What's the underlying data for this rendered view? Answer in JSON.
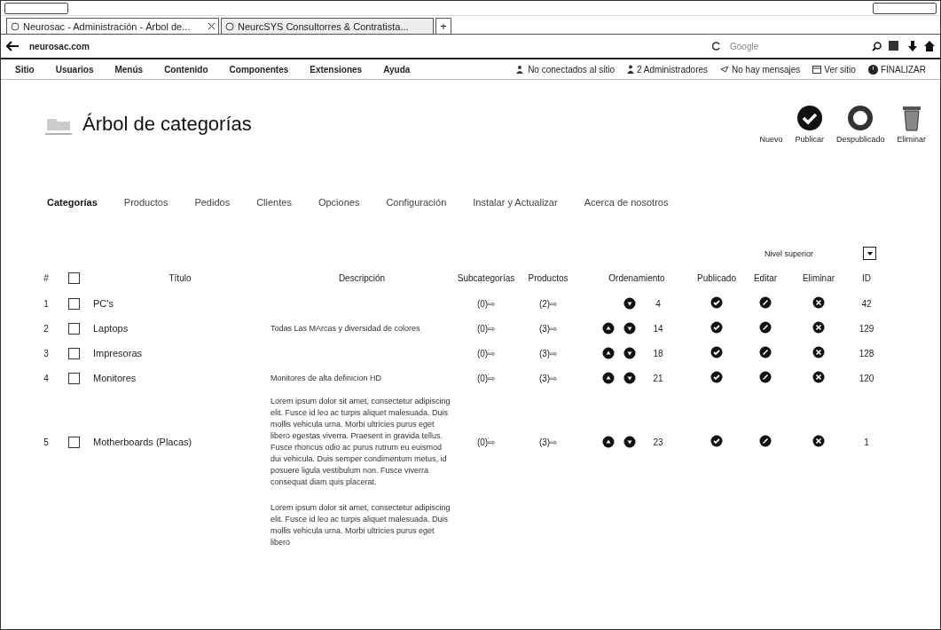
{
  "browser": {
    "tabs": [
      {
        "title": "Neurosac - Administración - Árbol de...",
        "selected": true,
        "closable": true
      },
      {
        "title": "NeurcSYS Consultorres & Contratista...",
        "selected": false,
        "closable": false
      }
    ],
    "new_tab": "+",
    "address": {
      "domain": "neurosac.com"
    },
    "search": {
      "placeholder": "Google"
    }
  },
  "admin_menu": {
    "items": [
      "Sitio",
      "Usuarios",
      "Menús",
      "Contenido",
      "Componentes",
      "Extensiones",
      "Ayuda"
    ],
    "status": [
      {
        "label": "No conectados al sitio",
        "kind": "users"
      },
      {
        "label": "2 Administradores",
        "kind": "admins"
      },
      {
        "label": "No hay mensajes",
        "kind": "messages"
      },
      {
        "label": "Ver sitio",
        "kind": "site"
      },
      {
        "label": "FINALIZAR",
        "kind": "logout"
      }
    ]
  },
  "page": {
    "title": "Árbol de categorías",
    "toolbar": [
      {
        "label": "Nuevo",
        "kind": "new"
      },
      {
        "label": "Publicar",
        "kind": "publish"
      },
      {
        "label": "Despublicado",
        "kind": "unpublish"
      },
      {
        "label": "Eliminar",
        "kind": "delete"
      }
    ]
  },
  "nav": [
    {
      "label": "Categorías",
      "selected": true
    },
    {
      "label": "Productos",
      "selected": false
    },
    {
      "label": "Pedidos",
      "selected": false
    },
    {
      "label": "Clientes",
      "selected": false
    },
    {
      "label": "Opciones",
      "selected": false
    },
    {
      "label": "Configuración",
      "selected": false
    },
    {
      "label": "Instalar y Actualizar",
      "selected": false
    },
    {
      "label": "Acerca de nosotros",
      "selected": false
    }
  ],
  "filter": {
    "label": "Nivel superior"
  },
  "table": {
    "select_all": {
      "checked": false
    },
    "columns": [
      "#",
      "Título",
      "Descripción",
      "Subcategorías",
      "Productos",
      "Ordenamiento",
      "Publicado",
      "Editar",
      "Eliminar",
      "ID"
    ],
    "rows": [
      {
        "num": "1",
        "checked": false,
        "title": "PC's",
        "description": "",
        "subcategories": "(0)⇨",
        "products": "(2)⇨",
        "up": false,
        "down": true,
        "order": "4",
        "published": true,
        "id": "42"
      },
      {
        "num": "2",
        "checked": false,
        "title": "Laptops",
        "description": "Todas Las MArcas y diversidad de colores",
        "subcategories": "(0)⇨",
        "products": "(3)⇨",
        "up": true,
        "down": true,
        "order": "14",
        "published": true,
        "id": "129"
      },
      {
        "num": "3",
        "checked": false,
        "title": "Impresoras",
        "description": "",
        "subcategories": "(0)⇨",
        "products": "(3)⇨",
        "up": true,
        "down": true,
        "order": "18",
        "published": true,
        "id": "128"
      },
      {
        "num": "4",
        "checked": false,
        "title": "Monitores",
        "description": "Monitores de alta definicion HD",
        "subcategories": "(0)⇨",
        "products": "(3)⇨",
        "up": true,
        "down": true,
        "order": "21",
        "published": true,
        "id": "120"
      },
      {
        "num": "5",
        "checked": false,
        "title": "Motherboards (Placas)",
        "description": "Lorem ipsum dolor sit amet, consectetur adipiscing elit. Fusce id leo ac turpis aliquet malesuada. Duis mollis vehicula urna. Morbi ultricies purus eget libero egestas viverra. Praesent in gravida tellus. Fusce rhoncus odio ac purus rutrum eu euismod dui vehicula. Duis semper condimentum metus, id posuere ligula vestibulum non. Fusce viverra consequat diam quis placerat.",
        "subcategories": "(0)⇨",
        "products": "(3)⇨",
        "up": true,
        "down": true,
        "order": "23",
        "published": true,
        "id": "1"
      },
      {
        "partial": true,
        "description": "Lorem ipsum dolor sit amet, consectetur adipiscing elit. Fusce id leo ac turpis aliquet malesuada. Duis mollis vehicula urna. Morbi ultricies purus eget libero"
      }
    ]
  }
}
